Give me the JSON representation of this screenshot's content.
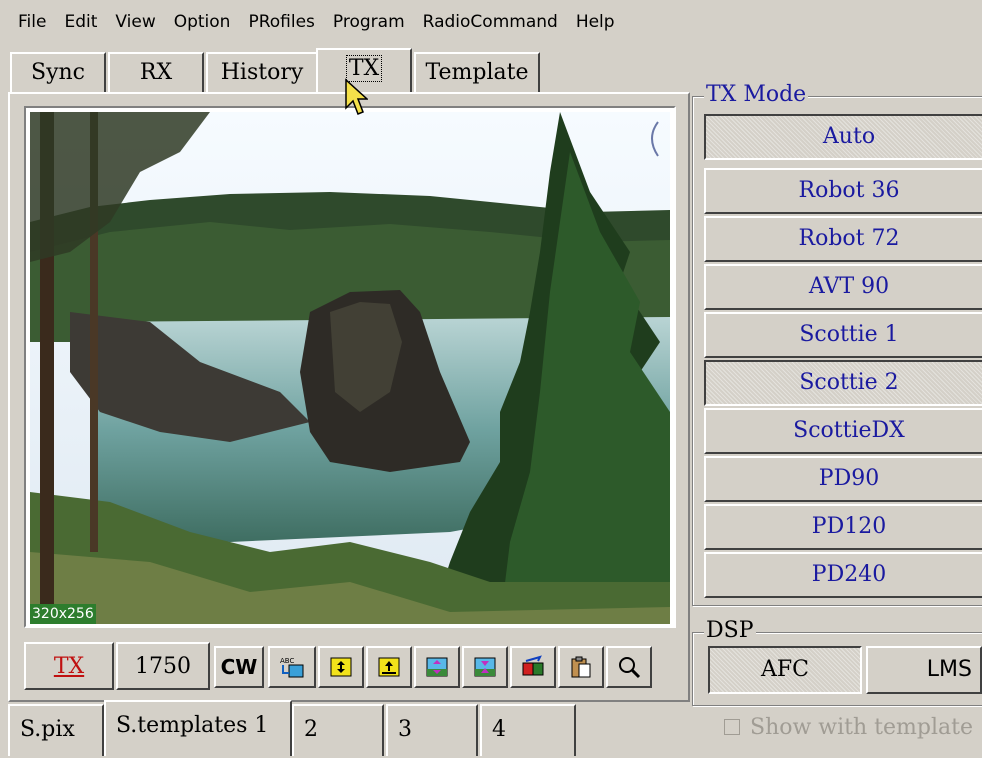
{
  "menu": [
    "File",
    "Edit",
    "View",
    "Option",
    "PRofiles",
    "Program",
    "RadioCommand",
    "Help"
  ],
  "tabs": [
    {
      "label": "Sync"
    },
    {
      "label": "RX"
    },
    {
      "label": "History"
    },
    {
      "label": "TX",
      "active": true
    },
    {
      "label": "Template"
    }
  ],
  "image": {
    "size_label": "320x256"
  },
  "toolbar": {
    "tx_label": "TX",
    "tone_label": "1750",
    "cw_label": "CW",
    "icons": [
      "abc-text-icon",
      "fit-vertical-icon",
      "upload-icon",
      "expand-image-icon",
      "shrink-image-icon",
      "mirror-image-icon",
      "paste-clipboard-icon",
      "zoom-icon"
    ]
  },
  "bottom_tabs": [
    "S.pix",
    "S.templates 1",
    "2",
    "3",
    "4"
  ],
  "tx_mode": {
    "legend": "TX Mode",
    "modes": [
      "Auto",
      "Robot 36",
      "Robot 72",
      "AVT 90",
      "Scottie 1",
      "Scottie 2",
      "ScottieDX",
      "PD90",
      "PD120",
      "PD240"
    ],
    "pressed": [
      "Auto",
      "Scottie 2"
    ]
  },
  "dsp": {
    "legend": "DSP",
    "afc_label": "AFC",
    "lms_label": "LMS"
  },
  "show_template": {
    "label": "Show with template",
    "checked": false
  },
  "colors": {
    "mode_text": "#1a1aa0",
    "tx_text": "#c01010",
    "badge_bg": "#2d7d2d"
  }
}
